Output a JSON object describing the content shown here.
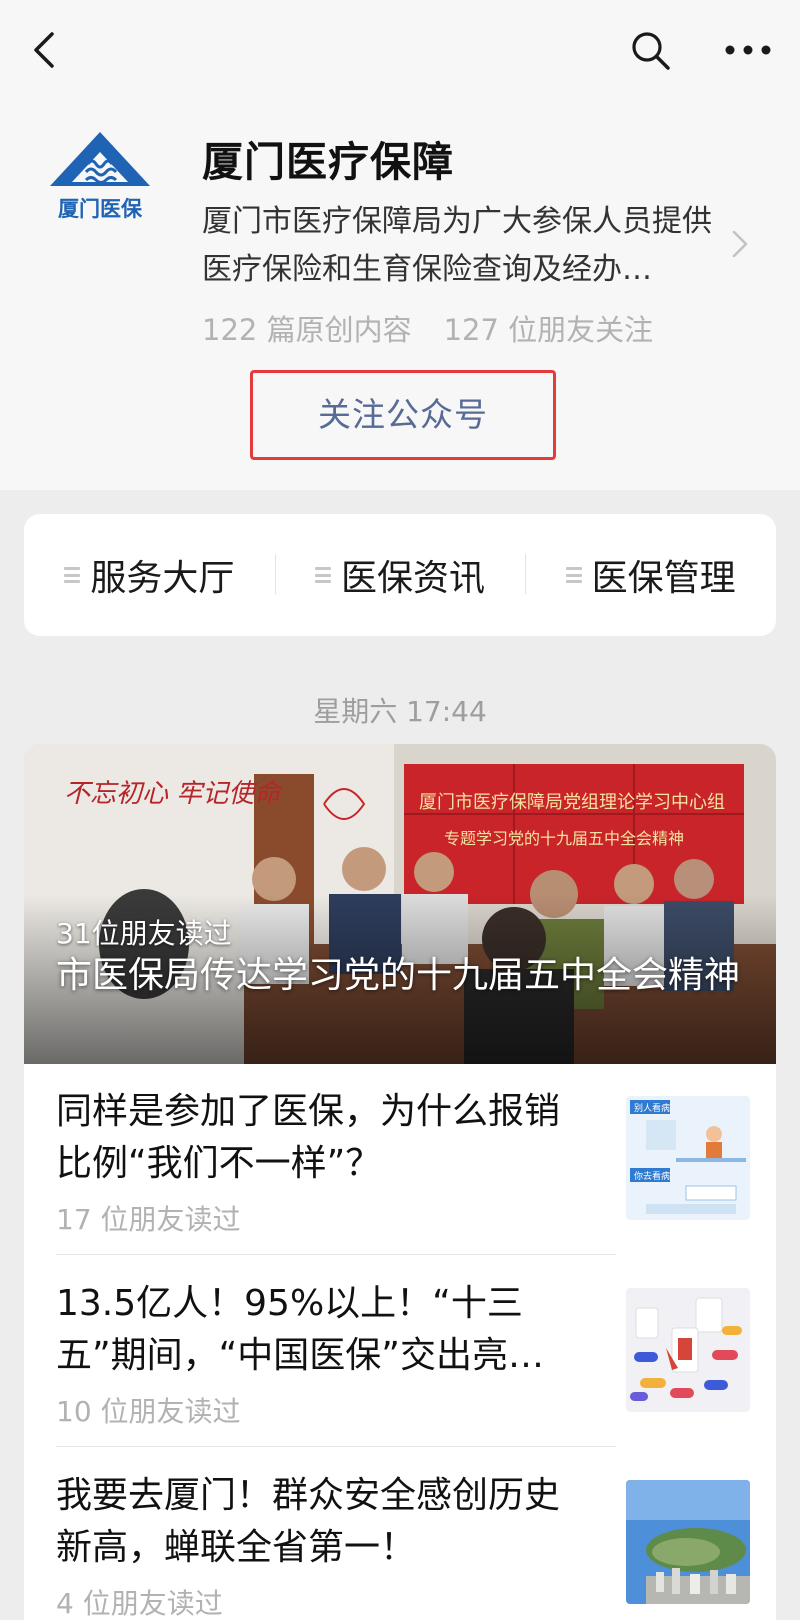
{
  "nav": {
    "back_icon": "back-chevron-icon",
    "search_icon": "search-icon",
    "more_icon": "more-dots-icon"
  },
  "account": {
    "logo_text": "厦门医保",
    "name": "厦门医疗保障",
    "description": "厦门市医疗保障局为广大参保人员提供医疗保险和生育保险查询及经办…",
    "original_count": "122 篇原创内容",
    "followers": "127 位朋友关注",
    "follow_label": "关注公众号"
  },
  "menu": {
    "items": [
      {
        "label": "服务大厅",
        "icon": "menu-lines-icon"
      },
      {
        "label": "医保资讯",
        "icon": "menu-lines-icon"
      },
      {
        "label": "医保管理",
        "icon": "menu-lines-icon"
      }
    ]
  },
  "feed": {
    "timestamp": "星期六 17:44",
    "cover": {
      "reads": "31位朋友读过",
      "title": "市医保局传达学习党的十九届五中全会精神",
      "banner_line1": "厦门市医疗保障局党组理论学习中心组",
      "banner_line2": "专题学习党的十九届五中全会精神",
      "wall_text": "不忘初心 牢记使命"
    },
    "articles": [
      {
        "title": "同样是参加了医保，为什么报销比例“我们不一样”？",
        "reads": "17 位朋友读过",
        "thumb_tag1": "别人看病",
        "thumb_tag2": "你去看病"
      },
      {
        "title": "13.5亿人！95%以上！“十三五”期间，“中国医保”交出亮…",
        "reads": "10 位朋友读过"
      },
      {
        "title": "我要去厦门！群众安全感创历史新高，蝉联全省第一！",
        "reads": "4 位朋友读过"
      }
    ]
  },
  "colors": {
    "link_blue": "#576b95",
    "highlight_red": "#e43a3a",
    "logo_blue": "#1f63b4"
  }
}
